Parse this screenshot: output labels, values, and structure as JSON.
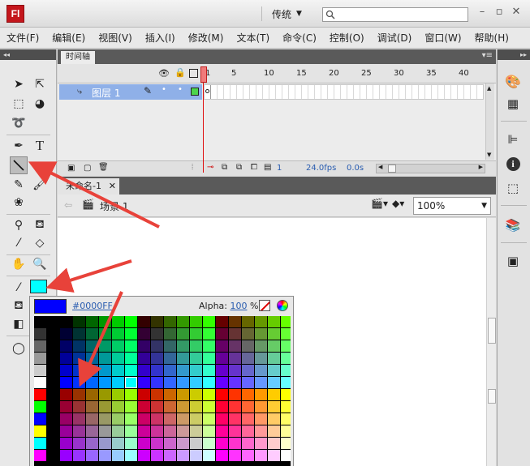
{
  "app": {
    "logo": "Fl",
    "workspace": "传统"
  },
  "menu": [
    "文件(F)",
    "编辑(E)",
    "视图(V)",
    "插入(I)",
    "修改(M)",
    "文本(T)",
    "命令(C)",
    "控制(O)",
    "调试(D)",
    "窗口(W)",
    "帮助(H)"
  ],
  "timeline": {
    "tab": "时间轴",
    "frame_numbers": [
      "1",
      "5",
      "10",
      "15",
      "20",
      "25",
      "30",
      "35",
      "40"
    ],
    "layer_name": "图层 1",
    "current_frame": "1",
    "fps": "24.0fps",
    "time": "0.0s"
  },
  "document": {
    "tab": "未命名-1",
    "scene": "场景 1",
    "zoom": "100%"
  },
  "tools": {
    "stroke_color": "#00FFFF",
    "fill_color": "#0000FF"
  },
  "swatches": {
    "hex": "#0000FF",
    "alpha_label": "Alpha:",
    "alpha_value": "100",
    "alpha_unit": "%"
  },
  "colors": {
    "annotation_arrow": "#e8423a",
    "layer_highlight": "#8fb0e8",
    "playhead": "#e01010"
  }
}
